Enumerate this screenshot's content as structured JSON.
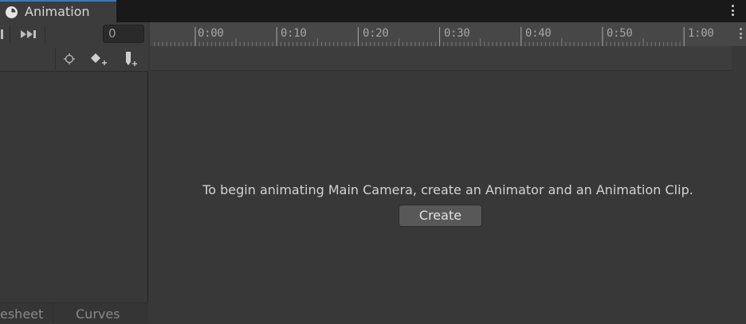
{
  "window": {
    "tab_title": "Animation",
    "tab_icon": "clock-icon"
  },
  "controls": {
    "frame_value": "0",
    "buttons": [
      "prev-keyframe-icon",
      "next-keyframe-icon",
      "crosshair-icon",
      "add-keyframe-icon",
      "add-event-icon"
    ]
  },
  "timeline": {
    "ticks": [
      "0:00",
      "0:10",
      "0:20",
      "0:30",
      "0:40",
      "0:50",
      "1:00"
    ]
  },
  "left_tabs": {
    "dopesheet": "esheet",
    "curves": "Curves"
  },
  "main": {
    "message": "To begin animating Main Camera, create an Animator and an Animation Clip.",
    "create_label": "Create"
  },
  "colors": {
    "background": "#383838",
    "tab_accent": "#3a79bb",
    "timeline": "#474747"
  }
}
